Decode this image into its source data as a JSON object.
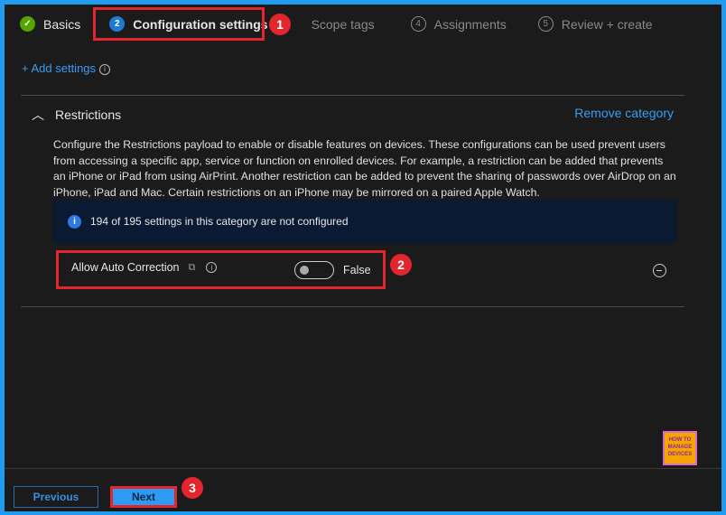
{
  "wizard": {
    "steps": [
      {
        "num": "✓",
        "label": "Basics",
        "state": "done"
      },
      {
        "num": "2",
        "label": "Configuration settings",
        "state": "current"
      },
      {
        "num": "3",
        "label": "Scope tags",
        "state": "todo"
      },
      {
        "num": "4",
        "label": "Assignments",
        "state": "todo"
      },
      {
        "num": "5",
        "label": "Review + create",
        "state": "todo"
      }
    ]
  },
  "add_settings": "+ Add settings",
  "category": {
    "title": "Restrictions",
    "remove": "Remove category",
    "description": "Configure the Restrictions payload to enable or disable features on devices. These configurations can be used prevent users from accessing a specific app, service or function on enrolled devices. For example, a restriction can be added that prevents an iPhone or iPad from using AirPrint. Another restriction can be added to prevent the sharing of passwords over AirDrop on an iPhone, iPad and Mac. Certain restrictions on an iPhone may be mirrored on a paired Apple Watch.",
    "banner": "194 of 195 settings in this category are not configured",
    "setting": {
      "label": "Allow Auto Correction",
      "value": "False",
      "enabled": false
    }
  },
  "annotations": [
    "1",
    "2",
    "3"
  ],
  "footer": {
    "previous": "Previous",
    "next": "Next"
  },
  "logo_text": "HOW TO MANAGE DEVICES",
  "colors": {
    "accent": "#3a9df2",
    "frame": "#1f9cf0",
    "highlight": "#e3262d"
  }
}
